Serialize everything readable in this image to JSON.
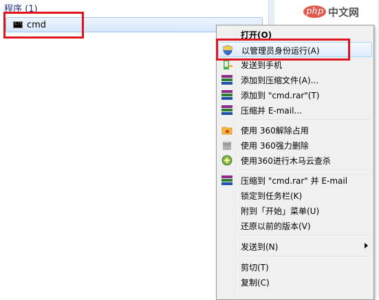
{
  "search_results": {
    "section_title": "程序 (1)",
    "items": [
      {
        "label": "cmd",
        "icon_text": "C:\\"
      }
    ]
  },
  "logo": {
    "php": "php",
    "cn": "中文网"
  },
  "context_menu": {
    "items": [
      {
        "label": "打开(O)",
        "icon": "none",
        "bold": true
      },
      {
        "label": "以管理员身份运行(A)",
        "icon": "uac-shield-icon",
        "highlighted": true
      },
      {
        "label": "发送到手机",
        "icon": "phone-send-icon"
      },
      {
        "label": "添加到压缩文件(A)...",
        "icon": "winrar-icon"
      },
      {
        "label": "添加到 \"cmd.rar\"(T)",
        "icon": "winrar-icon"
      },
      {
        "label": "压缩并 E-mail...",
        "icon": "winrar-icon"
      },
      {
        "label": "使用 360解除占用",
        "icon": "360-unlock-icon"
      },
      {
        "label": "使用 360强力删除",
        "icon": "360-shred-icon"
      },
      {
        "label": "使用360进行木马云查杀",
        "icon": "360-scan-icon"
      },
      {
        "label": "压缩到 \"cmd.rar\" 并 E-mail",
        "icon": "winrar-icon"
      },
      {
        "label": "锁定到任务栏(K)",
        "icon": "none"
      },
      {
        "label": "附到「开始」菜单(U)",
        "icon": "none"
      },
      {
        "label": "还原以前的版本(V)",
        "icon": "none"
      },
      {
        "label": "发送到(N)",
        "icon": "none",
        "submenu": true
      },
      {
        "label": "剪切(T)",
        "icon": "none"
      },
      {
        "label": "复制(C)",
        "icon": "none"
      }
    ]
  },
  "colors": {
    "highlight_box": "#e0141e",
    "section_title": "#1e3287"
  }
}
